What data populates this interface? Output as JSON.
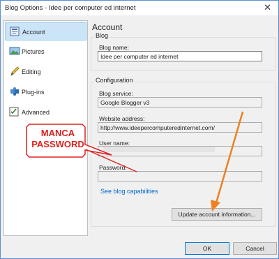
{
  "window": {
    "title": "Blog Options - Idee per computer ed internet",
    "close_glyph": "✕"
  },
  "sidebar": {
    "items": [
      {
        "label": "Account",
        "icon": "account-icon",
        "active": true
      },
      {
        "label": "Pictures",
        "icon": "pictures-icon",
        "active": false
      },
      {
        "label": "Editing",
        "icon": "pencil-icon",
        "active": false
      },
      {
        "label": "Plug-ins",
        "icon": "puzzle-icon",
        "active": false
      },
      {
        "label": "Advanced",
        "icon": "checklist-icon",
        "active": false
      }
    ]
  },
  "main": {
    "heading": "Account",
    "blog_group": {
      "title": "Blog",
      "blog_name_label": "Blog name:",
      "blog_name_value": "Idee per computer ed internet"
    },
    "config_group": {
      "title": "Configuration",
      "service_label": "Blog service:",
      "service_value": "Google Blogger v3",
      "address_label": "Website address:",
      "address_value": "http://www.ideepercomputeredinternet.com/",
      "username_label": "User name:",
      "username_value": "",
      "password_label": "Password:",
      "password_value": "",
      "capabilities_link": "See blog capabilities",
      "update_button": "Update account information..."
    }
  },
  "footer": {
    "ok_label": "OK",
    "cancel_label": "Cancel"
  },
  "annotation": {
    "callout_text": "MANCA PASSWORD",
    "callout_color": "#e02020",
    "arrow_color": "#f08020"
  }
}
